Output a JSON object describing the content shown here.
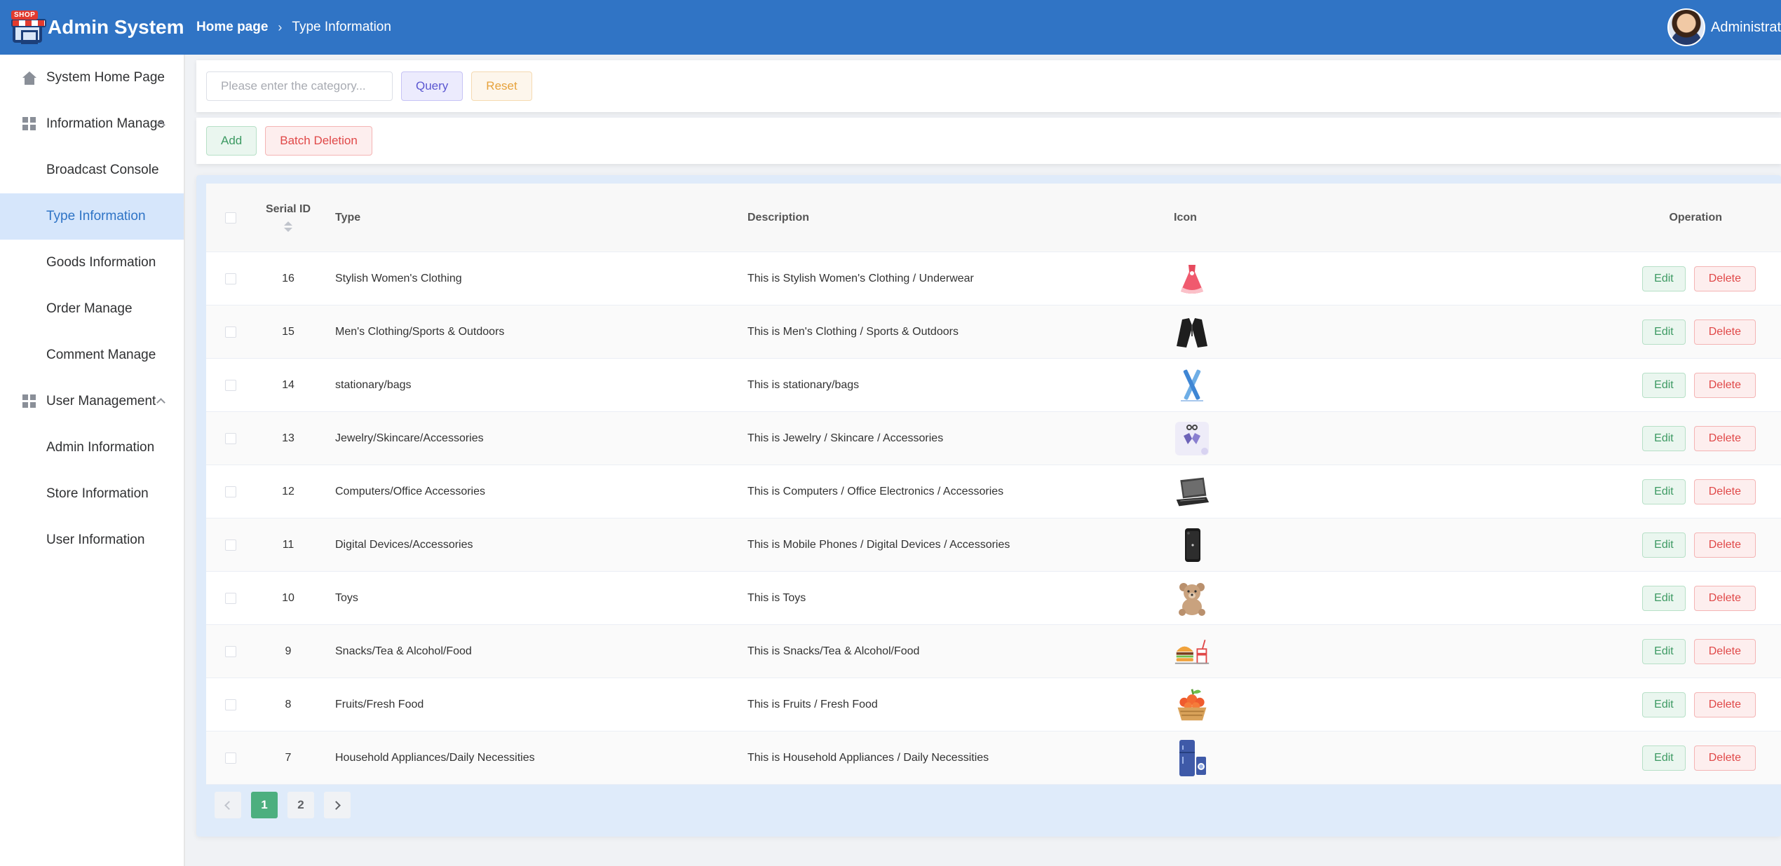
{
  "header": {
    "logo_badge": "SHOP",
    "title": "Admin System",
    "breadcrumb": {
      "home": "Home page",
      "current": "Type Information"
    },
    "username": "Administrator"
  },
  "sidebar": {
    "home": "System Home Page",
    "info_group": "Information Manage",
    "info_items": [
      "Broadcast Console",
      "Type Information",
      "Goods Information",
      "Order Manage",
      "Comment Manage"
    ],
    "user_group": "User Management",
    "user_items": [
      "Admin Information",
      "Store Information",
      "User Information"
    ]
  },
  "search": {
    "placeholder": "Please enter the category...",
    "query_label": "Query",
    "reset_label": "Reset"
  },
  "toolbar": {
    "add_label": "Add",
    "batch_delete_label": "Batch Deletion"
  },
  "table": {
    "columns": {
      "id": "Serial ID",
      "type": "Type",
      "description": "Description",
      "icon": "Icon",
      "operation": "Operation"
    },
    "edit_label": "Edit",
    "delete_label": "Delete",
    "rows": [
      {
        "id": "16",
        "type": "Stylish Women's Clothing",
        "description": "This is Stylish Women's Clothing / Underwear",
        "icon": "dress-icon"
      },
      {
        "id": "15",
        "type": "Men's Clothing/Sports & Outdoors",
        "description": "This is Men's Clothing / Sports & Outdoors",
        "icon": "suit-icon"
      },
      {
        "id": "14",
        "type": "stationary/bags",
        "description": "This is stationary/bags",
        "icon": "pencils-icon"
      },
      {
        "id": "13",
        "type": "Jewelry/Skincare/Accessories",
        "description": "This is Jewelry / Skincare / Accessories",
        "icon": "earrings-icon"
      },
      {
        "id": "12",
        "type": "Computers/Office Accessories",
        "description": "This is Computers / Office Electronics / Accessories",
        "icon": "laptop-icon"
      },
      {
        "id": "11",
        "type": "Digital Devices/Accessories",
        "description": "This is Mobile Phones / Digital Devices / Accessories",
        "icon": "smartphone-icon"
      },
      {
        "id": "10",
        "type": "Toys",
        "description": "This is Toys",
        "icon": "teddy-bear-icon"
      },
      {
        "id": "9",
        "type": "Snacks/Tea & Alcohol/Food",
        "description": "This is Snacks/Tea & Alcohol/Food",
        "icon": "burger-drink-icon"
      },
      {
        "id": "8",
        "type": "Fruits/Fresh Food",
        "description": "This is Fruits / Fresh Food",
        "icon": "fruit-basket-icon"
      },
      {
        "id": "7",
        "type": "Household Appliances/Daily Necessities",
        "description": "This is Household Appliances / Daily Necessities",
        "icon": "fridge-icon"
      }
    ]
  },
  "pagination": {
    "pages": [
      "1",
      "2"
    ],
    "current": "1"
  },
  "colors": {
    "header": "#3074c5",
    "active_menu": "#d6e6fb",
    "pager_active": "#4caf7f"
  }
}
